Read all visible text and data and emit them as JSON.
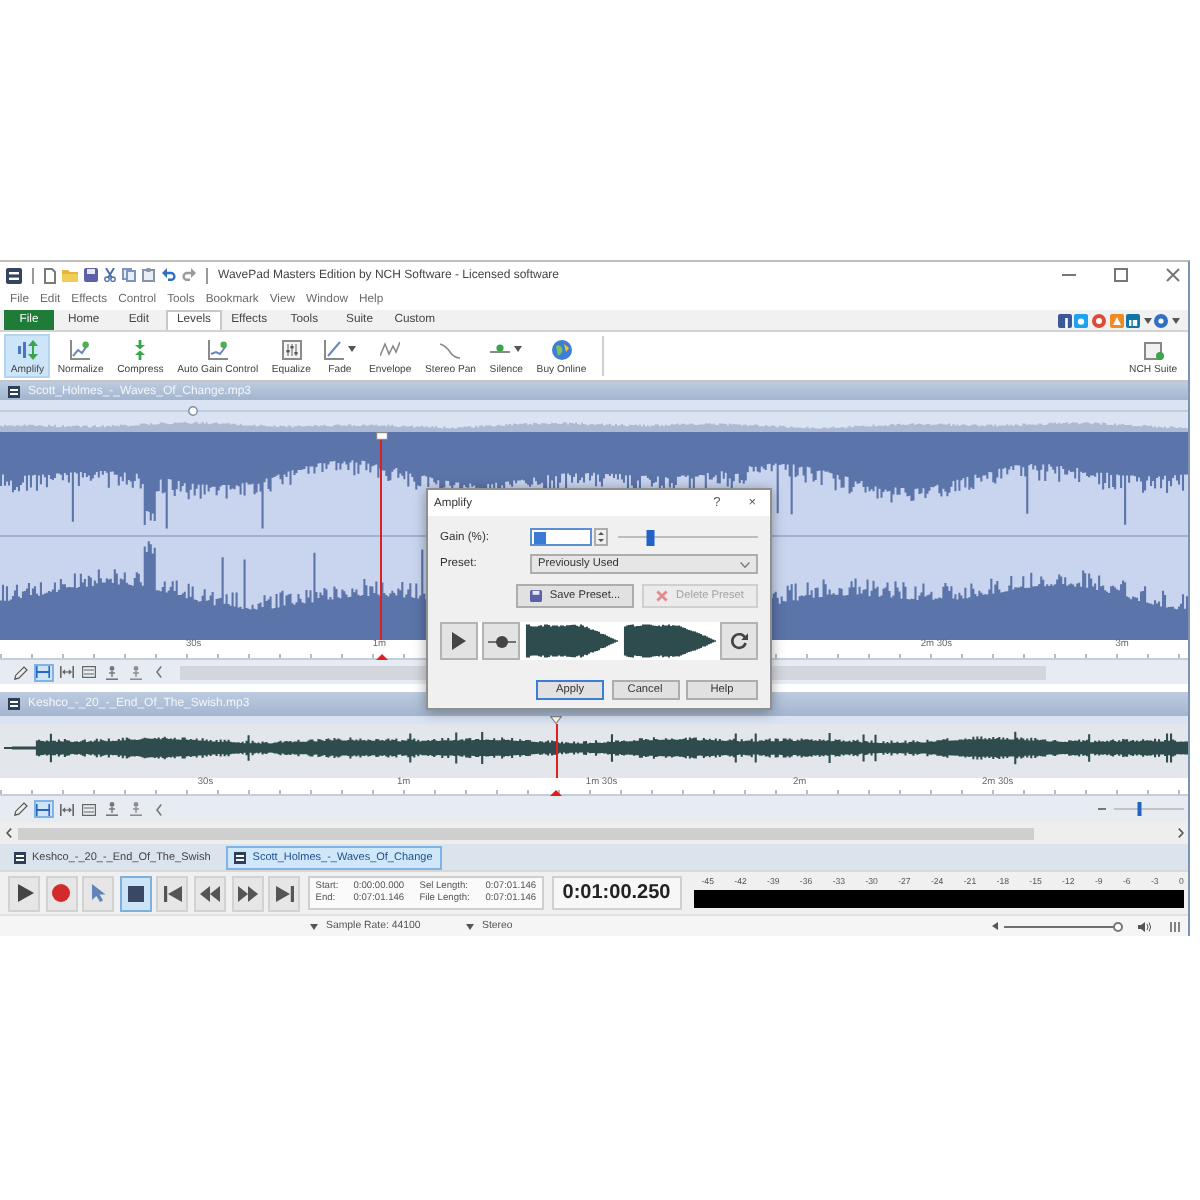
{
  "window": {
    "title": "WavePad Masters Edition by NCH Software - Licensed software"
  },
  "menu": [
    "File",
    "Edit",
    "Effects",
    "Control",
    "Tools",
    "Bookmark",
    "View",
    "Window",
    "Help"
  ],
  "ribbon_tabs": [
    {
      "label": "File",
      "kind": "file",
      "selected": false
    },
    {
      "label": "Home",
      "kind": "tab",
      "selected": false
    },
    {
      "label": "Edit",
      "kind": "tab",
      "selected": false
    },
    {
      "label": "Levels",
      "kind": "tab",
      "selected": true
    },
    {
      "label": "Effects",
      "kind": "tab",
      "selected": false
    },
    {
      "label": "Tools",
      "kind": "tab",
      "selected": false
    },
    {
      "label": "Suite",
      "kind": "tab",
      "selected": false
    },
    {
      "label": "Custom",
      "kind": "tab",
      "selected": false
    }
  ],
  "toolbar": [
    {
      "label": "Amplify",
      "selected": true,
      "dropdown": false
    },
    {
      "label": "Normalize",
      "selected": false,
      "dropdown": false
    },
    {
      "label": "Compress",
      "selected": false,
      "dropdown": false
    },
    {
      "label": "Auto Gain Control",
      "selected": false,
      "dropdown": false
    },
    {
      "label": "Equalize",
      "selected": false,
      "dropdown": false
    },
    {
      "label": "Fade",
      "selected": false,
      "dropdown": true
    },
    {
      "label": "Envelope",
      "selected": false,
      "dropdown": false
    },
    {
      "label": "Stereo Pan",
      "selected": false,
      "dropdown": false
    },
    {
      "label": "Silence",
      "selected": false,
      "dropdown": true
    },
    {
      "label": "Buy Online",
      "selected": false,
      "dropdown": false
    }
  ],
  "toolbar_right": {
    "label": "NCH Suite"
  },
  "tracks": [
    {
      "kind": "expanded",
      "file": "Scott_Holmes_-_Waves_Of_Change.mp3",
      "overview": {
        "level": 0.163
      },
      "playhead": {
        "level": 0.32
      },
      "timeline": [
        "30s",
        "1m",
        "2m 30s",
        "3m"
      ],
      "tools": [
        {
          "selected": false
        },
        {
          "selected": true
        },
        {
          "selected": false
        },
        {
          "selected": false
        },
        {
          "selected": false
        },
        {
          "selected": false
        },
        {
          "selected": false
        }
      ]
    },
    {
      "kind": "compact",
      "file": "Keshco_-_20_-_End_Of_The_Swish.mp3",
      "playhead": {
        "level": 0.468
      },
      "timeline": [
        "30s",
        "1m",
        "1m 30s",
        "2m",
        "2m 30s"
      ],
      "tools": [
        {
          "selected": false
        },
        {
          "selected": true
        },
        {
          "selected": false
        },
        {
          "selected": false
        },
        {
          "selected": false
        },
        {
          "selected": false
        },
        {
          "selected": false
        }
      ],
      "zoom": {
        "level": 0.37
      }
    }
  ],
  "dialog": {
    "title": "Amplify",
    "help_button": "?",
    "close_button": "×",
    "gain": {
      "label": "Gain (%):",
      "level": 0.23
    },
    "preset": {
      "label": "Preset:",
      "value": "Previously Used"
    },
    "preset_buttons": [
      {
        "label": "Save Preset...",
        "disabled": false
      },
      {
        "label": "Delete Preset",
        "disabled": true
      }
    ],
    "buttons": [
      {
        "label": "Apply",
        "default": true
      },
      {
        "label": "Cancel",
        "default": false
      },
      {
        "label": "Help",
        "default": false
      }
    ]
  },
  "file_tabs": [
    {
      "label": "Keshco_-_20_-_End_Of_The_Swish",
      "selected": false
    },
    {
      "label": "Scott_Holmes_-_Waves_Of_Change",
      "selected": true
    }
  ],
  "transport": [
    {
      "selected": false
    },
    {
      "selected": false
    },
    {
      "selected": false
    },
    {
      "selected": true
    },
    {
      "selected": false
    },
    {
      "selected": false
    },
    {
      "selected": false
    },
    {
      "selected": false
    }
  ],
  "selection": [
    {
      "label": "Start:",
      "value": "0:00:00.000"
    },
    {
      "label": "Sel Length:",
      "value": "0:07:01.146"
    },
    {
      "label": "End:",
      "value": "0:07:01.146"
    },
    {
      "label": "File Length:",
      "value": "0:07:01.146"
    }
  ],
  "time_display": "0:01:00.250",
  "meter": {
    "ticks": [
      "-45",
      "-42",
      "-39",
      "-36",
      "-33",
      "-30",
      "-27",
      "-24",
      "-21",
      "-18",
      "-15",
      "-12",
      "-9",
      "-6",
      "-3",
      "0"
    ]
  },
  "status_bar": {
    "sample_rate": "Sample Rate: 44100",
    "channels": "Stereo",
    "volume": {
      "level": 0.98
    }
  }
}
